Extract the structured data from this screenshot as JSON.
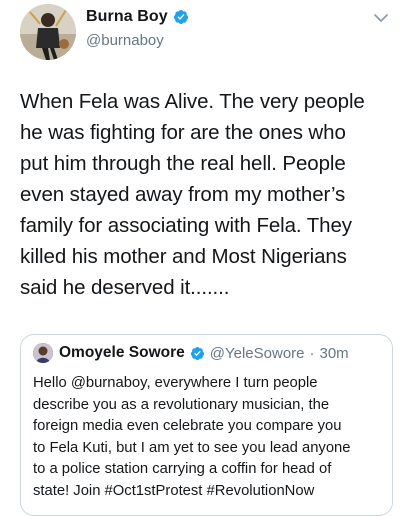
{
  "author": {
    "display_name": "Burna Boy",
    "handle": "@burnaboy",
    "verified": true,
    "avatar_icon": "profile-photo"
  },
  "tweet": {
    "lines": [
      "When Fela was Alive. The very people",
      "he was fighting for are the ones who",
      "put him through the real hell. People",
      "even stayed away from my mother’s",
      "family for associating with Fela. They",
      "killed his mother and Most Nigerians",
      "said he deserved it......."
    ]
  },
  "quoted_tweet": {
    "display_name": "Omoyele Sowore",
    "handle": "@YeleSowore",
    "separator": "·",
    "time": "30m",
    "verified": true,
    "lines": [
      "Hello @burnaboy, everywhere I turn people",
      "describe you as a revolutionary musician, the",
      "foreign media even celebrate you compare you",
      "to Fela Kuti, but I am yet to see you lead anyone",
      "to a police station carrying a coffin for head of",
      "state! Join #Oct1stProtest #RevolutionNow"
    ]
  },
  "colors": {
    "text_primary": "#14171a",
    "text_secondary": "#657786",
    "verified_blue": "#1da1f2",
    "border": "#ccd6dd"
  },
  "icons": [
    "verified-badge-icon",
    "chevron-down-icon"
  ]
}
